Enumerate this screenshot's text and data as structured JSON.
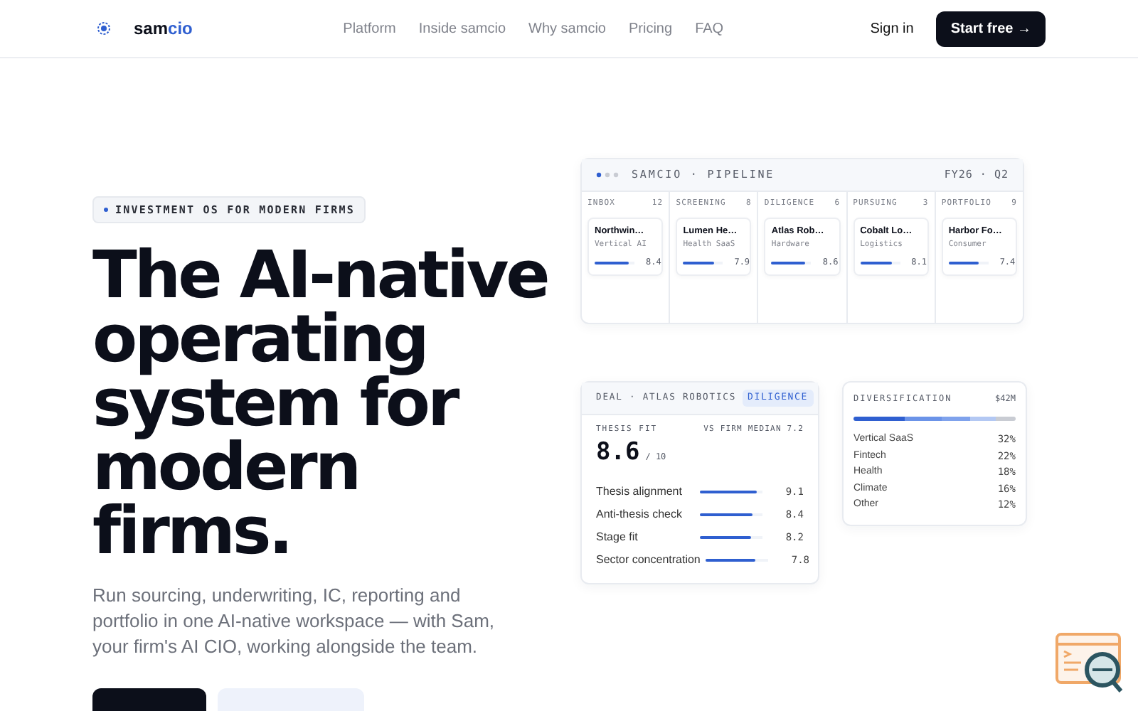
{
  "nav": {
    "brand_prefix": "sam",
    "brand_suffix": "cio",
    "links": [
      "Platform",
      "Inside samcio",
      "Why samcio",
      "Pricing",
      "FAQ"
    ],
    "sign_in": "Sign in",
    "cta": "Start free",
    "cta_arrow": "→"
  },
  "hero": {
    "badge": "INVESTMENT OS FOR MODERN FIRMS",
    "heading": "The AI-native operating system for modern firms.",
    "subtitle": "Run sourcing, underwriting, IC, reporting and portfolio in one AI-native workspace — with Sam, your firm's AI CIO, working alongside the team."
  },
  "pipeline": {
    "title": "SAMCIO · PIPELINE",
    "period": "FY26 · Q2",
    "columns": [
      {
        "name": "INBOX",
        "count": "12",
        "card": {
          "name": "Northwin…",
          "sector": "Vertical AI",
          "level": 0.84,
          "score": "8.4"
        }
      },
      {
        "name": "SCREENING",
        "count": "8",
        "card": {
          "name": "Lumen He…",
          "sector": "Health SaaS",
          "level": 0.79,
          "score": "7.9"
        }
      },
      {
        "name": "DILIGENCE",
        "count": "6",
        "card": {
          "name": "Atlas Rob…",
          "sector": "Hardware",
          "level": 0.86,
          "score": "8.6"
        }
      },
      {
        "name": "PURSUING",
        "count": "3",
        "card": {
          "name": "Cobalt Lo…",
          "sector": "Logistics",
          "level": 0.81,
          "score": "8.1"
        }
      },
      {
        "name": "PORTFOLIO",
        "count": "9",
        "card": {
          "name": "Harbor Fo…",
          "sector": "Consumer",
          "level": 0.74,
          "score": "7.4"
        }
      }
    ]
  },
  "deal": {
    "title": "DEAL · ATLAS ROBOTICS",
    "status": "DILIGENCE",
    "fit_label": "THESIS FIT",
    "median": "VS FIRM MEDIAN 7.2",
    "score": "8.6",
    "scale": "/ 10",
    "metrics": [
      {
        "name": "Thesis alignment",
        "level": 0.91,
        "value": "9.1"
      },
      {
        "name": "Anti-thesis check",
        "level": 0.84,
        "value": "8.4"
      },
      {
        "name": "Stage fit",
        "level": 0.82,
        "value": "8.2"
      },
      {
        "name": "Sector concentration",
        "level": 0.78,
        "value": "7.8"
      }
    ]
  },
  "diversification": {
    "title": "DIVERSIFICATION",
    "total": "$42M",
    "items": [
      {
        "name": "Vertical SaaS",
        "value": "32%",
        "color": "#2f5fd0"
      },
      {
        "name": "Fintech",
        "value": "22%",
        "color": "#6b93e8"
      },
      {
        "name": "Health",
        "value": "18%",
        "color": "#7fa2ec"
      },
      {
        "name": "Climate",
        "value": "16%",
        "color": "#b3c8f3"
      },
      {
        "name": "Other",
        "value": "12%",
        "color": "#c9ccd3"
      }
    ]
  }
}
